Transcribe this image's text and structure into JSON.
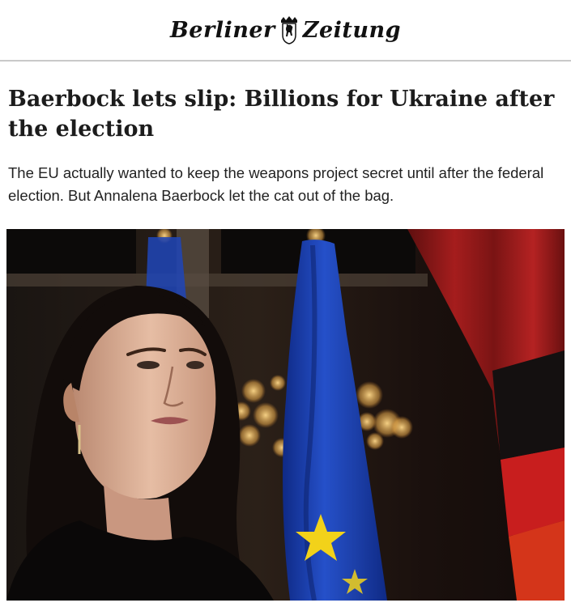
{
  "masthead": {
    "word_left": "Berliner",
    "word_right": "Zeitung"
  },
  "article": {
    "headline": "Baerbock lets slip: Billions for Ukraine after the election",
    "subhead": "The EU actually wanted to keep the weapons project secret until after the federal election. But Annalena Baerbock let the cat out of the bag."
  },
  "photo": {
    "subject": "woman-portrait",
    "flags": [
      "eu-flag",
      "german-flag"
    ]
  },
  "colors": {
    "text": "#1c1c1c",
    "divider": "#c9c9c9",
    "eu_blue": "#1f45b8",
    "eu_star": "#f2d21a",
    "german_red": "#d22a1a",
    "curtain_red": "#8e1a1a"
  }
}
